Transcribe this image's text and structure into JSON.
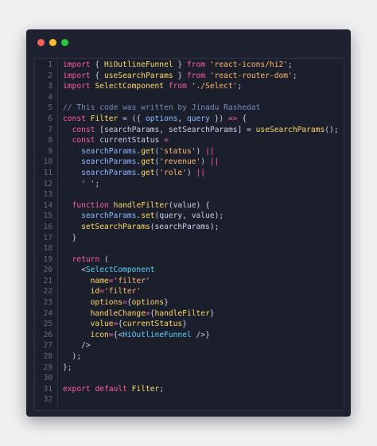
{
  "window": {
    "controls": [
      {
        "name": "close",
        "color": "#ff5f56"
      },
      {
        "name": "minimize",
        "color": "#ffbd2e"
      },
      {
        "name": "maximize",
        "color": "#27c93f"
      }
    ]
  },
  "lines": [
    {
      "n": "1",
      "tokens": [
        [
          "kw",
          "import"
        ],
        [
          "pl",
          " { "
        ],
        [
          "fn",
          "HiOutlineFunnel"
        ],
        [
          "pl",
          " } "
        ],
        [
          "kw",
          "from"
        ],
        [
          "pl",
          " "
        ],
        [
          "str",
          "'react-icons/hi2'"
        ],
        [
          "pl",
          ";"
        ]
      ]
    },
    {
      "n": "2",
      "tokens": [
        [
          "kw",
          "import"
        ],
        [
          "pl",
          " { "
        ],
        [
          "fn",
          "useSearchParams"
        ],
        [
          "pl",
          " } "
        ],
        [
          "kw",
          "from"
        ],
        [
          "pl",
          " "
        ],
        [
          "str",
          "'react-router-dom'"
        ],
        [
          "pl",
          ";"
        ]
      ]
    },
    {
      "n": "3",
      "tokens": [
        [
          "kw",
          "import"
        ],
        [
          "pl",
          " "
        ],
        [
          "fn",
          "SelectComponent"
        ],
        [
          "pl",
          " "
        ],
        [
          "kw",
          "from"
        ],
        [
          "pl",
          " "
        ],
        [
          "str",
          "'./Select'"
        ],
        [
          "pl",
          ";"
        ]
      ]
    },
    {
      "n": "4",
      "tokens": []
    },
    {
      "n": "5",
      "tokens": [
        [
          "cm",
          "// This code was written by Jinadu Rashedat"
        ]
      ]
    },
    {
      "n": "6",
      "tokens": [
        [
          "kw",
          "const"
        ],
        [
          "pl",
          " "
        ],
        [
          "fn",
          "Filter"
        ],
        [
          "pl",
          " = ({ "
        ],
        [
          "var",
          "options"
        ],
        [
          "pl",
          ", "
        ],
        [
          "var",
          "query"
        ],
        [
          "pl",
          " }) "
        ],
        [
          "kw",
          "=>"
        ],
        [
          "pl",
          " {"
        ]
      ]
    },
    {
      "n": "7",
      "tokens": [
        [
          "pl",
          "  "
        ],
        [
          "kw",
          "const"
        ],
        [
          "pl",
          " [searchParams, setSearchParams] = "
        ],
        [
          "fn",
          "useSearchParams"
        ],
        [
          "pl",
          "();"
        ]
      ]
    },
    {
      "n": "8",
      "tokens": [
        [
          "pl",
          "  "
        ],
        [
          "kw",
          "const"
        ],
        [
          "pl",
          " currentStatus "
        ],
        [
          "kw",
          "="
        ]
      ]
    },
    {
      "n": "9",
      "tokens": [
        [
          "pl",
          "    "
        ],
        [
          "var",
          "searchParams"
        ],
        [
          "pl",
          "."
        ],
        [
          "fn",
          "get"
        ],
        [
          "pl",
          "("
        ],
        [
          "str",
          "'status'"
        ],
        [
          "pl",
          ") "
        ],
        [
          "kw",
          "||"
        ]
      ]
    },
    {
      "n": "10",
      "tokens": [
        [
          "pl",
          "    "
        ],
        [
          "var",
          "searchParams"
        ],
        [
          "pl",
          "."
        ],
        [
          "fn",
          "get"
        ],
        [
          "pl",
          "("
        ],
        [
          "str",
          "'revenue'"
        ],
        [
          "pl",
          ") "
        ],
        [
          "kw",
          "||"
        ]
      ]
    },
    {
      "n": "11",
      "tokens": [
        [
          "pl",
          "    "
        ],
        [
          "var",
          "searchParams"
        ],
        [
          "pl",
          "."
        ],
        [
          "fn",
          "get"
        ],
        [
          "pl",
          "("
        ],
        [
          "str",
          "'role'"
        ],
        [
          "pl",
          ") "
        ],
        [
          "kw",
          "||"
        ]
      ]
    },
    {
      "n": "12",
      "tokens": [
        [
          "pl",
          "    "
        ],
        [
          "str",
          "' '"
        ],
        [
          "pl",
          ";"
        ]
      ]
    },
    {
      "n": "13",
      "tokens": []
    },
    {
      "n": "14",
      "tokens": [
        [
          "pl",
          "  "
        ],
        [
          "kw",
          "function"
        ],
        [
          "pl",
          " "
        ],
        [
          "fn",
          "handleFilter"
        ],
        [
          "pl",
          "(value) {"
        ]
      ]
    },
    {
      "n": "15",
      "tokens": [
        [
          "pl",
          "    "
        ],
        [
          "var",
          "searchParams"
        ],
        [
          "pl",
          "."
        ],
        [
          "fn",
          "set"
        ],
        [
          "pl",
          "(query, value);"
        ]
      ]
    },
    {
      "n": "16",
      "tokens": [
        [
          "pl",
          "    "
        ],
        [
          "fn",
          "setSearchParams"
        ],
        [
          "pl",
          "(searchParams);"
        ]
      ]
    },
    {
      "n": "17",
      "tokens": [
        [
          "pl",
          "  }"
        ]
      ]
    },
    {
      "n": "18",
      "tokens": []
    },
    {
      "n": "19",
      "tokens": [
        [
          "pl",
          "  "
        ],
        [
          "kw",
          "return"
        ],
        [
          "pl",
          " ("
        ]
      ]
    },
    {
      "n": "20",
      "tokens": [
        [
          "pl",
          "    <"
        ],
        [
          "comp",
          "SelectComponent"
        ]
      ]
    },
    {
      "n": "21",
      "tokens": [
        [
          "pl",
          "      "
        ],
        [
          "fn",
          "name"
        ],
        [
          "kw",
          "="
        ],
        [
          "str",
          "'filter'"
        ]
      ]
    },
    {
      "n": "22",
      "tokens": [
        [
          "pl",
          "      "
        ],
        [
          "fn",
          "id"
        ],
        [
          "kw",
          "="
        ],
        [
          "str",
          "'filter'"
        ]
      ]
    },
    {
      "n": "23",
      "tokens": [
        [
          "pl",
          "      "
        ],
        [
          "fn",
          "options"
        ],
        [
          "kw",
          "="
        ],
        [
          "pl",
          "{"
        ],
        [
          "fn",
          "options"
        ],
        [
          "pl",
          "}"
        ]
      ]
    },
    {
      "n": "24",
      "tokens": [
        [
          "pl",
          "      "
        ],
        [
          "fn",
          "handleChange"
        ],
        [
          "kw",
          "="
        ],
        [
          "pl",
          "{"
        ],
        [
          "fn",
          "handleFilter"
        ],
        [
          "pl",
          "}"
        ]
      ]
    },
    {
      "n": "25",
      "tokens": [
        [
          "pl",
          "      "
        ],
        [
          "fn",
          "value"
        ],
        [
          "kw",
          "="
        ],
        [
          "pl",
          "{"
        ],
        [
          "fn",
          "currentStatus"
        ],
        [
          "pl",
          "}"
        ]
      ]
    },
    {
      "n": "26",
      "tokens": [
        [
          "pl",
          "      "
        ],
        [
          "fn",
          "icon"
        ],
        [
          "kw",
          "="
        ],
        [
          "pl",
          "{<"
        ],
        [
          "comp",
          "HiOutlineFunnel"
        ],
        [
          "pl",
          " />}"
        ]
      ]
    },
    {
      "n": "27",
      "tokens": [
        [
          "pl",
          "    />"
        ]
      ]
    },
    {
      "n": "28",
      "tokens": [
        [
          "pl",
          "  );"
        ]
      ]
    },
    {
      "n": "29",
      "tokens": [
        [
          "pl",
          "};"
        ]
      ]
    },
    {
      "n": "30",
      "tokens": []
    },
    {
      "n": "31",
      "tokens": [
        [
          "kw",
          "export"
        ],
        [
          "pl",
          " "
        ],
        [
          "kw",
          "default"
        ],
        [
          "pl",
          " "
        ],
        [
          "fn",
          "Filter"
        ],
        [
          "pl",
          ";"
        ]
      ]
    },
    {
      "n": "32",
      "tokens": []
    }
  ]
}
